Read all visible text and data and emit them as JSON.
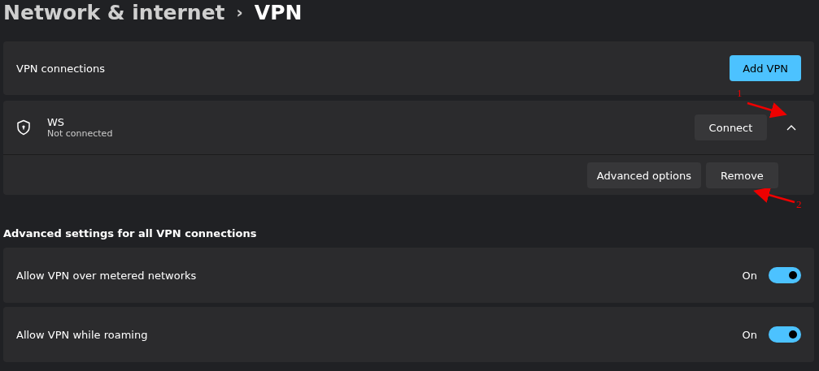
{
  "breadcrumb": {
    "parent": "Network & internet",
    "separator": "›",
    "current": "VPN"
  },
  "connections_card": {
    "label": "VPN connections",
    "button": "Add VPN"
  },
  "vpn": {
    "name": "WS",
    "status": "Not connected",
    "expanded": true,
    "connect_button": "Connect",
    "actions": [
      "Advanced options",
      "Remove"
    ]
  },
  "annotations": [
    {
      "label": "1"
    },
    {
      "label": "2"
    }
  ],
  "section_title": "Advanced settings for all VPN connections",
  "settings": [
    {
      "label": "Allow VPN over metered networks",
      "state_text": "On",
      "on": true
    },
    {
      "label": "Allow VPN while roaming",
      "state_text": "On",
      "on": true
    }
  ]
}
